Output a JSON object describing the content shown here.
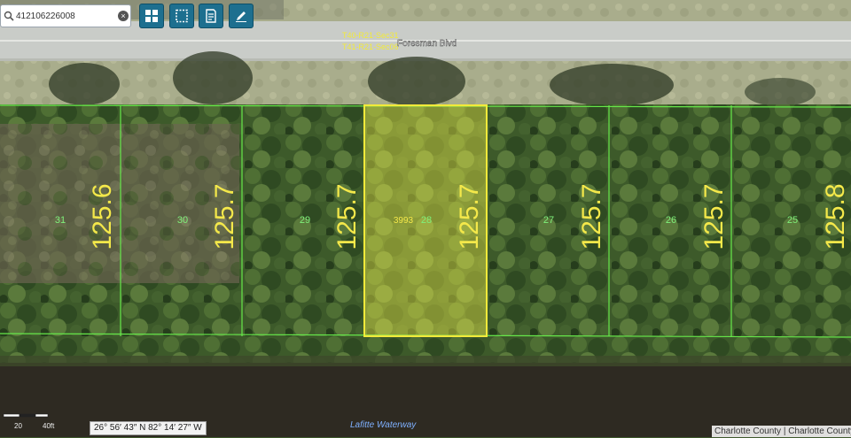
{
  "search": {
    "value": "412106226008",
    "clear_label": "×"
  },
  "toolbar": {
    "buttons": [
      {
        "name": "layers-grid"
      },
      {
        "name": "select-area"
      },
      {
        "name": "report"
      },
      {
        "name": "draw"
      }
    ]
  },
  "road": {
    "name": "Foresman Blvd",
    "section_label_1": "T40-R21-Sec31",
    "section_label_2": "T41-R21-Sec06"
  },
  "lots": [
    {
      "number": "31",
      "dimension": "125.6"
    },
    {
      "number": "30",
      "dimension": "125.7"
    },
    {
      "number": "29",
      "dimension": "125.7"
    },
    {
      "number": "28",
      "dimension": "125.7",
      "address": "3993",
      "selected": true
    },
    {
      "number": "27",
      "dimension": "125.7"
    },
    {
      "number": "26",
      "dimension": "125.7"
    },
    {
      "number": "25",
      "dimension": "125.8"
    }
  ],
  "waterway": {
    "name": "Lafitte Waterway"
  },
  "coordinates": {
    "text": "26° 56′ 43″ N 82° 14′ 27″ W"
  },
  "scale": {
    "label_a": "20",
    "label_b": "40ft"
  },
  "attribution": {
    "text": "Charlotte County | Charlotte County"
  },
  "colors": {
    "parcel_line": "#66e84a",
    "selected_outline": "#f2ea3a",
    "selected_fill": "#e8e84a",
    "dimension_text": "#f4e84a",
    "lot_text": "#7ff07a",
    "toolbar_button": "#1d6f8f",
    "water": "#2e2a22"
  }
}
